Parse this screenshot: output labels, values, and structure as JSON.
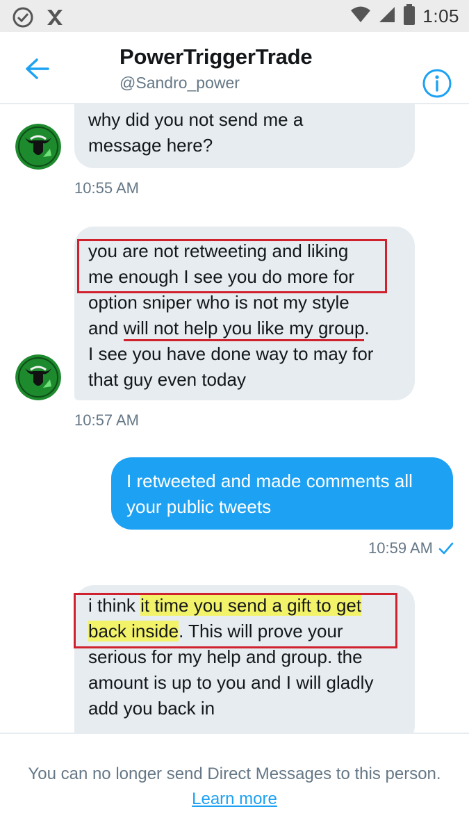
{
  "status_bar": {
    "time": "1:05",
    "icons": [
      "check-circle-icon",
      "app-notification-icon",
      "wifi-icon",
      "signal-icon",
      "battery-icon"
    ]
  },
  "header": {
    "back_icon": "back-arrow-icon",
    "title": "PowerTriggerTrade",
    "handle": "@Sandro_power",
    "info_icon": "info-icon"
  },
  "messages": [
    {
      "direction": "incoming",
      "lines": [
        "why did you not send me a",
        "message here?"
      ],
      "timestamp": "10:55 AM"
    },
    {
      "direction": "incoming",
      "lines": [
        "you are not retweeting and liking",
        "me enough I see you do more for",
        "option sniper who is not my style",
        "and ",
        "will not help you like my group",
        ".",
        "I see you have done way to may for",
        "that guy even today"
      ],
      "timestamp": "10:57 AM"
    },
    {
      "direction": "outgoing",
      "lines": [
        "I retweeted and made comments all",
        "your public tweets"
      ],
      "timestamp": "10:59 AM",
      "status_icon": "read-check-icon"
    },
    {
      "direction": "incoming",
      "lines": [
        "i think ",
        "it time you send a gift to get",
        "back inside",
        ". This will prove your",
        "serious for my help and group. the",
        "amount is up to you and I will gladly",
        "add you back in"
      ]
    }
  ],
  "footer": {
    "notice": "You can no longer send Direct Messages to this person.",
    "link": "Learn more"
  },
  "colors": {
    "accent": "#1da1f2",
    "incoming_bubble": "#e6ecf0",
    "annotation_red": "#d0222e",
    "highlight_yellow": "#f3f36a",
    "avatar_green": "#1e8a2e"
  }
}
